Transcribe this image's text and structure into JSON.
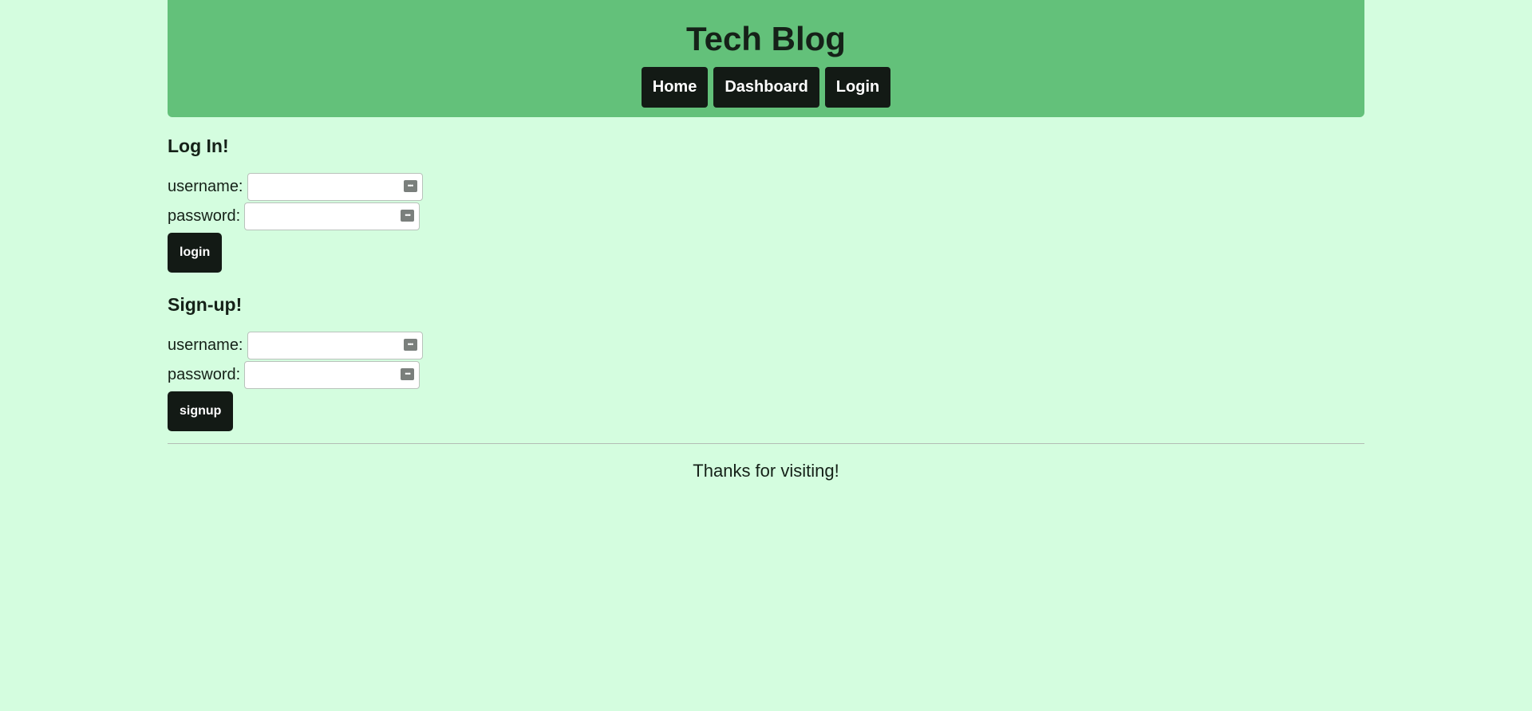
{
  "header": {
    "title": "Tech Blog",
    "nav": [
      "Home",
      "Dashboard",
      "Login"
    ]
  },
  "login": {
    "heading": "Log In!",
    "username_label": "username:",
    "password_label": "password:",
    "username_value": "",
    "password_value": "",
    "button_label": "login"
  },
  "signup": {
    "heading": "Sign-up!",
    "username_label": "username:",
    "password_label": "password:",
    "username_value": "",
    "password_value": "",
    "button_label": "signup"
  },
  "footer": {
    "text": "Thanks for visiting!"
  },
  "icons": {
    "field_icon": "password-manager-icon"
  },
  "colors": {
    "background": "#d4fddf",
    "header": "#63c17a",
    "button": "#131a15"
  }
}
